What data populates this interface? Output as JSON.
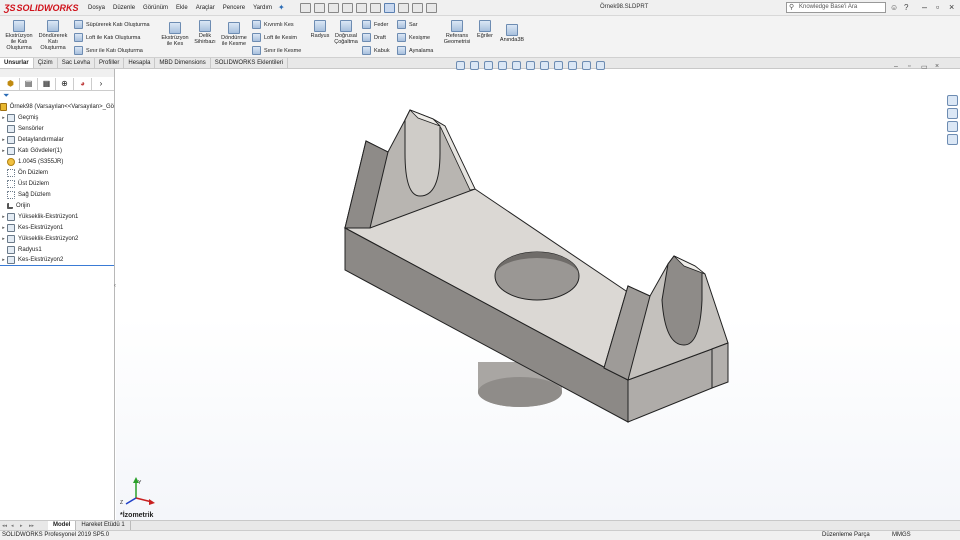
{
  "app": {
    "brand": "SOLIDWORKS",
    "document_title": "Örnek98.SLDPRT"
  },
  "menus": [
    "Dosya",
    "Düzenle",
    "Görünüm",
    "Ekle",
    "Araçlar",
    "Pencere",
    "Yardım"
  ],
  "search": {
    "placeholder": "Knowledge Base'i Ara"
  },
  "ribbon": {
    "extrude_boss": "Ekstrüzyon ile Katı Oluşturma",
    "revolve_boss": "Döndürerek Katı Oluşturma",
    "sweep_boss": "Süpürerek Katı Oluşturma",
    "loft_boss": "Loft ile Katı Oluşturma",
    "boundary_boss": "Sınır ile Katı Oluşturma",
    "extrude_cut": "Ekstrüzyon ile Kes",
    "hole_wizard": "Delik Sihirbazı",
    "revolve_cut": "Döndürme ile Kesme",
    "swept_cut": "Kıvrımlı Kes",
    "loft_cut": "Loft ile Kesim",
    "boundary_cut": "Sınır ile Kesme",
    "fillet": "Radyus",
    "linear_pattern": "Doğrusal Çoğaltma",
    "rib": "Feder",
    "draft": "Draft",
    "shell": "Kabuk",
    "wrap": "Sar",
    "intersect": "Kesişme",
    "mirror": "Aynalama",
    "reference_geometry": "Referans Geometrisi",
    "curves": "Eğriler",
    "instant3d": "Anında3B"
  },
  "command_tabs": [
    "Unsurlar",
    "Çizim",
    "Sac Levha",
    "Profiller",
    "Hesapla",
    "MBD Dimensions",
    "SOLIDWORKS Eklentileri"
  ],
  "feature_tree": [
    {
      "label": "Örnek98  (Varsayılan<<Varsayılan>_Gö",
      "icon": "part-icon",
      "root": true
    },
    {
      "label": "Geçmiş",
      "icon": "history-icon",
      "expand": true
    },
    {
      "label": "Sensörler",
      "icon": "sensor-icon"
    },
    {
      "label": "Detaylandırmalar",
      "icon": "annotations-icon",
      "expand": true
    },
    {
      "label": "Katı Gövdeler(1)",
      "icon": "solid-bodies-icon",
      "expand": true
    },
    {
      "label": "1.0045 (S355JR)",
      "icon": "material-icon"
    },
    {
      "label": "Ön Düzlem",
      "icon": "plane-icon"
    },
    {
      "label": "Üst Düzlem",
      "icon": "plane-icon"
    },
    {
      "label": "Sağ Düzlem",
      "icon": "plane-icon"
    },
    {
      "label": "Orijin",
      "icon": "origin-icon"
    },
    {
      "label": "Yükseklik-Ekstrüzyon1",
      "icon": "boss-extrude-icon",
      "expand": true
    },
    {
      "label": "Kes-Ekstrüzyon1",
      "icon": "cut-extrude-icon",
      "expand": true
    },
    {
      "label": "Yükseklik-Ekstrüzyon2",
      "icon": "boss-extrude-icon",
      "expand": true
    },
    {
      "label": "Radyus1",
      "icon": "fillet-icon"
    },
    {
      "label": "Kes-Ekstrüzyon2",
      "icon": "cut-extrude-icon",
      "expand": true
    }
  ],
  "viewport": {
    "view_label": "*İzometrik"
  },
  "bottom_tabs": [
    "Model",
    "Hareket Etüdü 1"
  ],
  "status": {
    "version": "SOLIDWORKS Profesyonel 2019 SP5.0",
    "mode": "Düzenleme Parça",
    "units": "MMGS"
  }
}
